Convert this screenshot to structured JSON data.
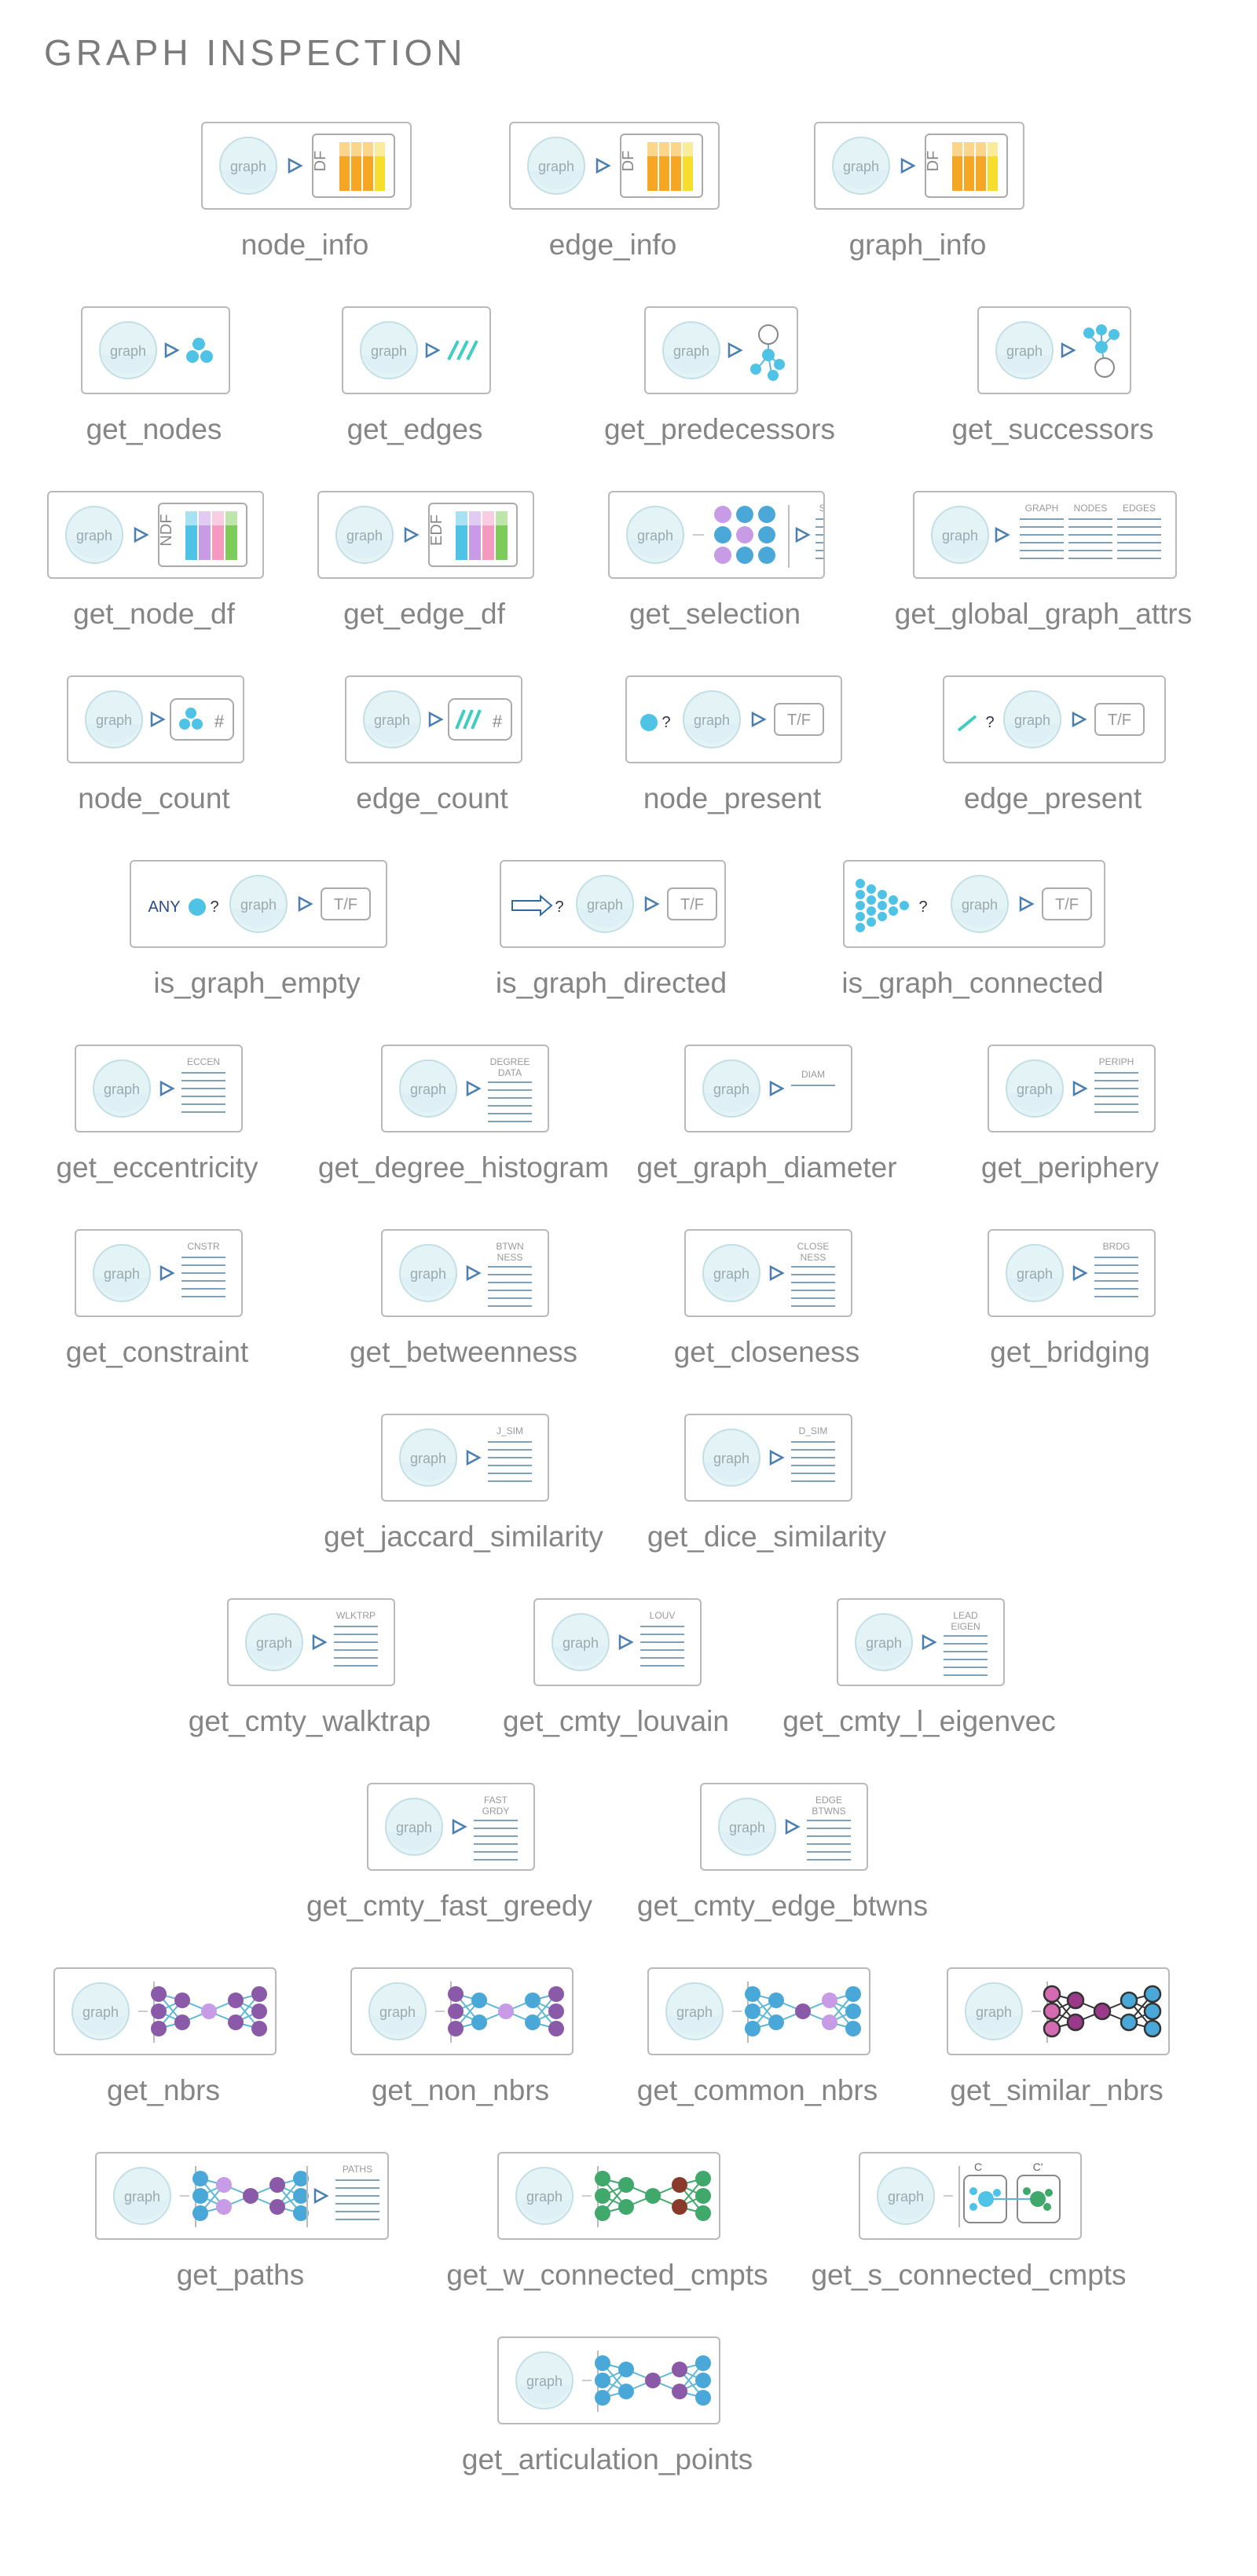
{
  "title": "GRAPH INSPECTION",
  "colors": {
    "accent": "#4ec3e6",
    "blue": "#4aa8d8",
    "purple": "#8a5aa8",
    "lavender": "#c79be6",
    "green": "#3fa86a",
    "orange": "#f5a623",
    "yellow": "#f7dd2e",
    "frame": "#b9b9b9",
    "text": "#858585"
  },
  "glyphs": {
    "graph": "graph",
    "df": "DF",
    "ndf": "NDF",
    "edf": "EDF",
    "tf": "T/F",
    "hash": "#",
    "any": "ANY",
    "q": "?",
    "c": "C",
    "cprime": "C'"
  },
  "items": [
    {
      "label": "node_info",
      "icon": "df-table"
    },
    {
      "label": "edge_info",
      "icon": "df-table"
    },
    {
      "label": "graph_info",
      "icon": "df-table"
    },
    {
      "label": "get_nodes",
      "icon": "nodes-cluster"
    },
    {
      "label": "get_edges",
      "icon": "edges-slashes"
    },
    {
      "label": "get_predecessors",
      "icon": "predecessors-tree"
    },
    {
      "label": "get_successors",
      "icon": "successors-tree"
    },
    {
      "label": "get_node_df",
      "icon": "ndf-table"
    },
    {
      "label": "get_edge_df",
      "icon": "edf-table"
    },
    {
      "label": "get_selection",
      "icon": "selection-grid",
      "tag": "SELECT"
    },
    {
      "label": "get_global_graph_attrs",
      "icon": "attr-columns",
      "columns": [
        "GRAPH",
        "NODES",
        "EDGES"
      ]
    },
    {
      "label": "node_count",
      "icon": "count-nodes"
    },
    {
      "label": "edge_count",
      "icon": "count-edges"
    },
    {
      "label": "node_present",
      "icon": "node-query"
    },
    {
      "label": "edge_present",
      "icon": "edge-query"
    },
    {
      "label": "is_graph_empty",
      "icon": "any-query"
    },
    {
      "label": "is_graph_directed",
      "icon": "arrow-query"
    },
    {
      "label": "is_graph_connected",
      "icon": "triangle-query"
    },
    {
      "label": "get_eccentricity",
      "icon": "list",
      "tag": "ECCEN"
    },
    {
      "label": "get_degree_histogram",
      "icon": "list",
      "tag": "DEGREE",
      "tag2": "DATA"
    },
    {
      "label": "get_graph_diameter",
      "icon": "single-value",
      "tag": "DIAM"
    },
    {
      "label": "get_periphery",
      "icon": "list",
      "tag": "PERIPH"
    },
    {
      "label": "get_constraint",
      "icon": "list",
      "tag": "CNSTR"
    },
    {
      "label": "get_betweenness",
      "icon": "list",
      "tag": "BTWN",
      "tag2": "NESS"
    },
    {
      "label": "get_closeness",
      "icon": "list",
      "tag": "CLOSE",
      "tag2": "NESS"
    },
    {
      "label": "get_bridging",
      "icon": "list",
      "tag": "BRDG"
    },
    {
      "label": "get_jaccard_similarity",
      "icon": "list",
      "tag": "J_SIM"
    },
    {
      "label": "get_dice_similarity",
      "icon": "list",
      "tag": "D_SIM"
    },
    {
      "label": "get_cmty_walktrap",
      "icon": "list",
      "tag": "WLKTRP"
    },
    {
      "label": "get_cmty_louvain",
      "icon": "list",
      "tag": "LOUV"
    },
    {
      "label": "get_cmty_l_eigenvec",
      "icon": "list",
      "tag": "LEAD",
      "tag2": "EIGEN"
    },
    {
      "label": "get_cmty_fast_greedy",
      "icon": "list",
      "tag": "FAST",
      "tag2": "GRDY"
    },
    {
      "label": "get_cmty_edge_btwns",
      "icon": "list",
      "tag": "EDGE",
      "tag2": "BTWNS"
    },
    {
      "label": "get_nbrs",
      "icon": "network-nbrs"
    },
    {
      "label": "get_non_nbrs",
      "icon": "network-non-nbrs"
    },
    {
      "label": "get_common_nbrs",
      "icon": "network-common"
    },
    {
      "label": "get_similar_nbrs",
      "icon": "network-similar"
    },
    {
      "label": "get_paths",
      "icon": "network-paths",
      "tag": "PATHS"
    },
    {
      "label": "get_w_connected_cmpts",
      "icon": "network-weak"
    },
    {
      "label": "get_s_connected_cmpts",
      "icon": "network-strong"
    },
    {
      "label": "get_articulation_points",
      "icon": "network-articulation"
    }
  ]
}
